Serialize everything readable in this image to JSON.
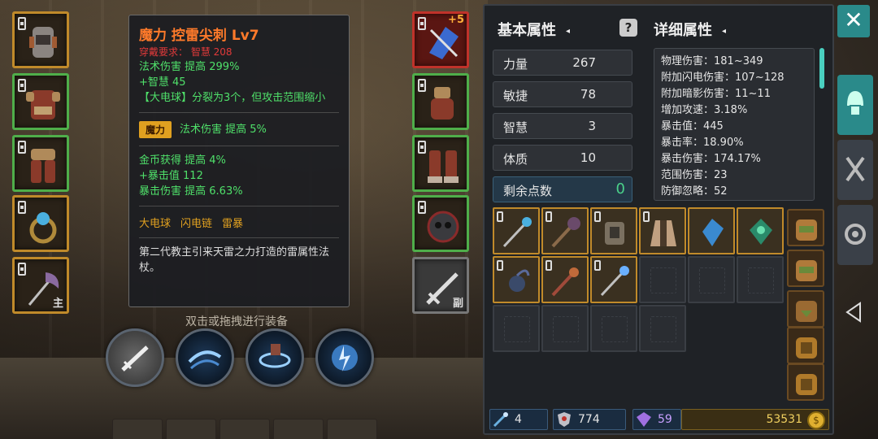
{
  "tooltip": {
    "title": "魔力 控雷尖刺 Lv7",
    "requirement": "穿戴要求：  智慧 208",
    "base_stats": [
      "法术伤害 提高 299%",
      "+智慧 45",
      "【大电球】分裂为3个，但攻击范围缩小"
    ],
    "enchant_badge": "魔力",
    "enchant_stat": "法术伤害 提高 5%",
    "extra_stats": [
      "金币获得 提高 4%",
      "+暴击值 112",
      "暴击伤害 提高 6.63%"
    ],
    "skills": [
      "大电球",
      "闪电链",
      "雷暴"
    ],
    "description": "第二代教主引来天雷之力打造的雷属性法杖。"
  },
  "hint": "双击或拖拽进行装备",
  "equipment": {
    "left": [
      {
        "name": "helmet",
        "border": "#c08a2a"
      },
      {
        "name": "chest-armor",
        "border": "#4fae4a"
      },
      {
        "name": "leg-armor",
        "border": "#4fae4a"
      },
      {
        "name": "ring",
        "border": "#c08a2a"
      },
      {
        "name": "main-weapon",
        "border": "#c08a2a",
        "tag": "主"
      }
    ],
    "right": [
      {
        "name": "amulet",
        "border": "#c0322a",
        "plus": "+5"
      },
      {
        "name": "gloves",
        "border": "#4fae4a"
      },
      {
        "name": "boots",
        "border": "#4fae4a"
      },
      {
        "name": "ring-2",
        "border": "#4fae4a"
      },
      {
        "name": "off-weapon",
        "border": "#777",
        "tag": "副"
      }
    ]
  },
  "basic": {
    "title": "基本属性",
    "rows": [
      {
        "label": "力量",
        "value": "267"
      },
      {
        "label": "敏捷",
        "value": "78"
      },
      {
        "label": "智慧",
        "value": "3"
      },
      {
        "label": "体质",
        "value": "10"
      }
    ],
    "points_label": "剩余点数",
    "points_value": "0"
  },
  "detail": {
    "title": "详细属性",
    "lines": [
      "物理伤害：181~349",
      "附加闪电伤害：107~128",
      "附加暗影伤害：11~11",
      "增加攻速：3.18%",
      "暴击值：445",
      "暴击率：18.90%",
      "暴击伤害：174.17%",
      "范围伤害：23",
      "防御忽略：52"
    ]
  },
  "resources": {
    "wand_count": "4",
    "shield_count": "774",
    "gem_count": "59",
    "gold": "53531"
  },
  "colors": {
    "accent_teal": "#2a8a8a",
    "title_orange": "#ff7a2a",
    "stat_green": "#4fe06a",
    "requirement_red": "#e23a3a",
    "gold_border": "#c08a2a"
  }
}
